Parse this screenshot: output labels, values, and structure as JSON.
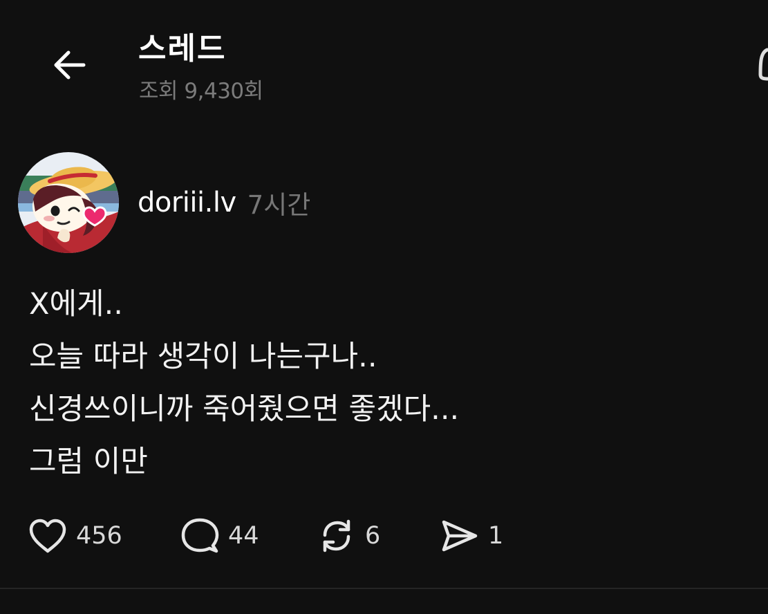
{
  "header": {
    "title": "스레드",
    "views": "조회 9,430회"
  },
  "post": {
    "username": "doriii.lv",
    "time": "7시간",
    "lines": [
      "X에게..",
      "오늘 따라 생각이 나는구나..",
      "신경쓰이니까 죽어줬으면 좋겠다...",
      "그럼 이만"
    ],
    "avatar_icon": "cartoon-avatar"
  },
  "actions": {
    "likes": "456",
    "replies": "44",
    "reposts": "6",
    "shares": "1"
  },
  "colors": {
    "background": "#101010",
    "primary_text": "#f3f3f3",
    "secondary_text": "#777777"
  }
}
